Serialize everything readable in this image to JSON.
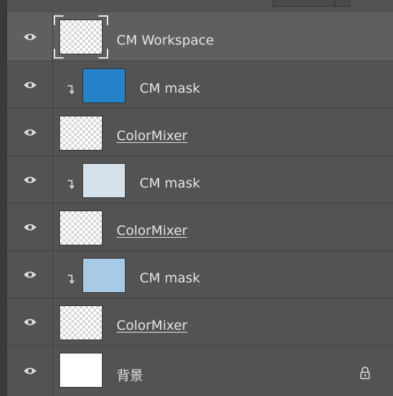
{
  "panel": "layers",
  "layers": [
    {
      "name": "CM Workspace",
      "thumbnail": "transparent",
      "selected": true,
      "clipped": false,
      "smart_object": false,
      "visible": true
    },
    {
      "name": "CM mask",
      "thumbnail": "#2682c8",
      "selected": false,
      "clipped": true,
      "smart_object": false,
      "visible": true
    },
    {
      "name": "ColorMixer",
      "thumbnail": "transparent",
      "selected": false,
      "clipped": false,
      "smart_object": true,
      "visible": true
    },
    {
      "name": "CM mask",
      "thumbnail": "#d5e2ec",
      "selected": false,
      "clipped": true,
      "smart_object": false,
      "visible": true
    },
    {
      "name": "ColorMixer",
      "thumbnail": "transparent",
      "selected": false,
      "clipped": false,
      "smart_object": true,
      "visible": true
    },
    {
      "name": "CM mask",
      "thumbnail": "#a7cbe6",
      "selected": false,
      "clipped": true,
      "smart_object": false,
      "visible": true
    },
    {
      "name": "ColorMixer",
      "thumbnail": "transparent",
      "selected": false,
      "clipped": false,
      "smart_object": true,
      "visible": true
    },
    {
      "name": "背景",
      "thumbnail": "#ffffff",
      "selected": false,
      "clipped": false,
      "smart_object": false,
      "visible": true,
      "locked": true
    }
  ],
  "icons": {
    "visibility": "eye-icon",
    "clipping": "clipping-arrow-icon",
    "lock": "lock-icon"
  },
  "colors": {
    "panel_bg": "#535353",
    "selected_bg": "#5f5f5f",
    "text": "#e4e4e4"
  }
}
